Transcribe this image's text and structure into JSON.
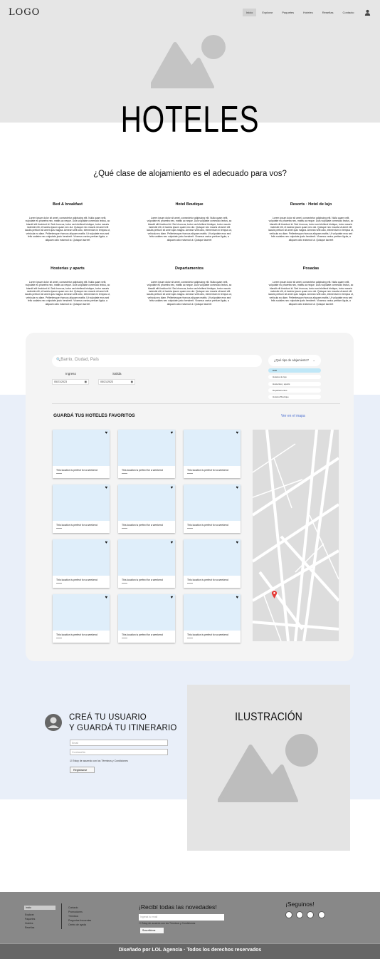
{
  "header": {
    "logo": "LOGO",
    "nav": [
      "Inicio",
      "Explorar",
      "Paquetes",
      "Hoteles",
      "Reseñas",
      "Contacto"
    ],
    "active_nav": "Inicio"
  },
  "hero": {
    "title": "HOTELES",
    "image_icon": "image-placeholder-icon"
  },
  "intro": {
    "question": "¿Qué clase de alojamiento es el adecuado para vos?"
  },
  "categories": [
    {
      "title": "Bed & breakfast",
      "text": "Lorem ipsum dolor sit amet, consectetur adipiscing elit. Nulla quam velit, vulputate eu pharetra nec, mattis ac neque. Duis vulputate commodo lectus, ac blandit elit tincidunt id. Sed rhoncus, tortor sed eleifend tristique, tortor mauris molestie elit, et lacinia ipsum quam nec dui. Quisque nec mauris sit amet elit iaculis pretium sit amet quis magna. Aenean velit odio, elementum in tempus ut, vehicula eu diam. Pellentesque rhoncus aliquam mattis. Ut vulputate eros sed felis sodales nec vulputate justo hendrerit. Vivamus varius pretium ligula, a aliquam odio euismod ut. Quisque laoreet"
    },
    {
      "title": "Hotel Boutique",
      "text": "Lorem ipsum dolor sit amet, consectetur adipiscing elit. Nulla quam velit, vulputate eu pharetra nec, mattis ac neque. Duis vulputate commodo lectus, ac blandit elit tincidunt id. Sed rhoncus, tortor sed eleifend tristique, tortor mauris molestie elit, et lacinia ipsum quam nec dui. Quisque nec mauris sit amet elit iaculis pretium sit amet quis magna. Aenean velit odio, elementum in tempus ut, vehicula eu diam. Pellentesque rhoncus aliquam mattis. Ut vulputate eros sed felis sodales nec vulputate justo hendrerit. Vivamus varius pretium ligula, a aliquam odio euismod ut. Quisque laoreet"
    },
    {
      "title": "Resorts · Hotel de lujo",
      "text": "Lorem ipsum dolor sit amet, consectetur adipiscing elit. Nulla quam velit, vulputate eu pharetra nec, mattis ac neque. Duis vulputate commodo lectus, ac blandit elit tincidunt id. Sed rhoncus, tortor sed eleifend tristique, tortor mauris molestie elit, et lacinia ipsum quam nec dui. Quisque nec mauris sit amet elit iaculis pretium sit amet quis magna. Aenean velit odio, elementum in tempus ut, vehicula eu diam. Pellentesque rhoncus aliquam mattis. Ut vulputate eros sed felis sodales nec vulputate justo hendrerit. Vivamus varius pretium ligula, a aliquam odio euismod ut. Quisque laoreet"
    },
    {
      "title": "Hosterías y aparts",
      "text": "Lorem ipsum dolor sit amet, consectetur adipiscing elit. Nulla quam velit, vulputate eu pharetra nec, mattis ac neque. Duis vulputate commodo lectus, ac blandit elit tincidunt id. Sed rhoncus, tortor sed eleifend tristique, tortor mauris molestie elit, et lacinia ipsum quam nec dui. Quisque nec mauris sit amet elit iaculis pretium sit amet quis magna. Aenean velit odio, elementum in tempus ut, vehicula eu diam. Pellentesque rhoncus aliquam mattis. Ut vulputate eros sed felis sodales nec vulputate justo hendrerit. Vivamus varius pretium ligula, a aliquam odio euismod ut. Quisque laoreet"
    },
    {
      "title": "Departamentos",
      "text": "Lorem ipsum dolor sit amet, consectetur adipiscing elit. Nulla quam velit, vulputate eu pharetra nec, mattis ac neque. Duis vulputate commodo lectus, ac blandit elit tincidunt id. Sed rhoncus, tortor sed eleifend tristique, tortor mauris molestie elit, et lacinia ipsum quam nec dui. Quisque nec mauris sit amet elit iaculis pretium sit amet quis magna. Aenean velit odio, elementum in tempus ut, vehicula eu diam. Pellentesque rhoncus aliquam mattis. Ut vulputate eros sed felis sodales nec vulputate justo hendrerit. Vivamus varius pretium ligula, a aliquam odio euismod ut. Quisque laoreet"
    },
    {
      "title": "Posadas",
      "text": "Lorem ipsum dolor sit amet, consectetur adipiscing elit. Nulla quam velit, vulputate eu pharetra nec, mattis ac neque. Duis vulputate commodo lectus, ac blandit elit tincidunt id. Sed rhoncus, tortor sed eleifend tristique, tortor mauris molestie elit, et lacinia ipsum quam nec dui. Quisque nec mauris sit amet elit iaculis pretium sit amet quis magna. Aenean velit odio, elementum in tempus ut, vehicula eu diam. Pellentesque rhoncus aliquam mattis. Ut vulputate eros sed felis sodales nec vulputate justo hendrerit. Vivamus varius pretium ligula, a aliquam odio euismod ut. Quisque laoreet"
    }
  ],
  "search": {
    "placeholder": "Barrio, Ciudad, País",
    "checkin_label": "Ingreso",
    "checkin_value": "05/21/2023",
    "checkout_label": "Salida",
    "checkout_value": "05/21/2023",
    "type_select": "¿Qué tipo de alojamiento?",
    "type_options": [
      "B&B",
      "Hoteles de lujo",
      "Hosterías y aparts",
      "Departamentos",
      "Hoteles Boutique"
    ]
  },
  "favorites": {
    "title": "GUARDÁ TUS HOTELES FAVORITOS",
    "map_link": "Ver en el mapa",
    "card_text": "This location is perfect for a weekend",
    "cards_count": 12
  },
  "register": {
    "title1": "CREÁ TU USUARIO",
    "title2": "Y GUARDÁ TU ITINERARIO",
    "email_placeholder": "Email",
    "password_placeholder": "Contraseña",
    "terms": "Estoy de acuerdo con los Términos y Condiciones",
    "button": "Registrarse"
  },
  "illustration": {
    "title": "ILUSTRACIÓN"
  },
  "footer": {
    "col1": [
      "Inicio",
      "Explorar",
      "Paquetes",
      "Hoteles",
      "Reseñas"
    ],
    "col2": [
      "Contacto",
      "Promociones",
      "Términos",
      "Preguntas frecuentes",
      "Centro de ayuda"
    ],
    "news_title": "¡Recibí todas las novedades!",
    "news_placeholder": "Ingresá tu email",
    "news_terms": "Estoy de acuerdo con los Términos y Condiciones",
    "news_button": "Suscribirme",
    "follow": "¡Seguinos!",
    "copyright": "Diseñado por LOL Agencia · Todos los derechos reservados"
  },
  "colors": {
    "accent": "#bfe7f7",
    "link": "#4b6fd1",
    "pin": "#e53935",
    "blue_band": "#e9eff9"
  }
}
